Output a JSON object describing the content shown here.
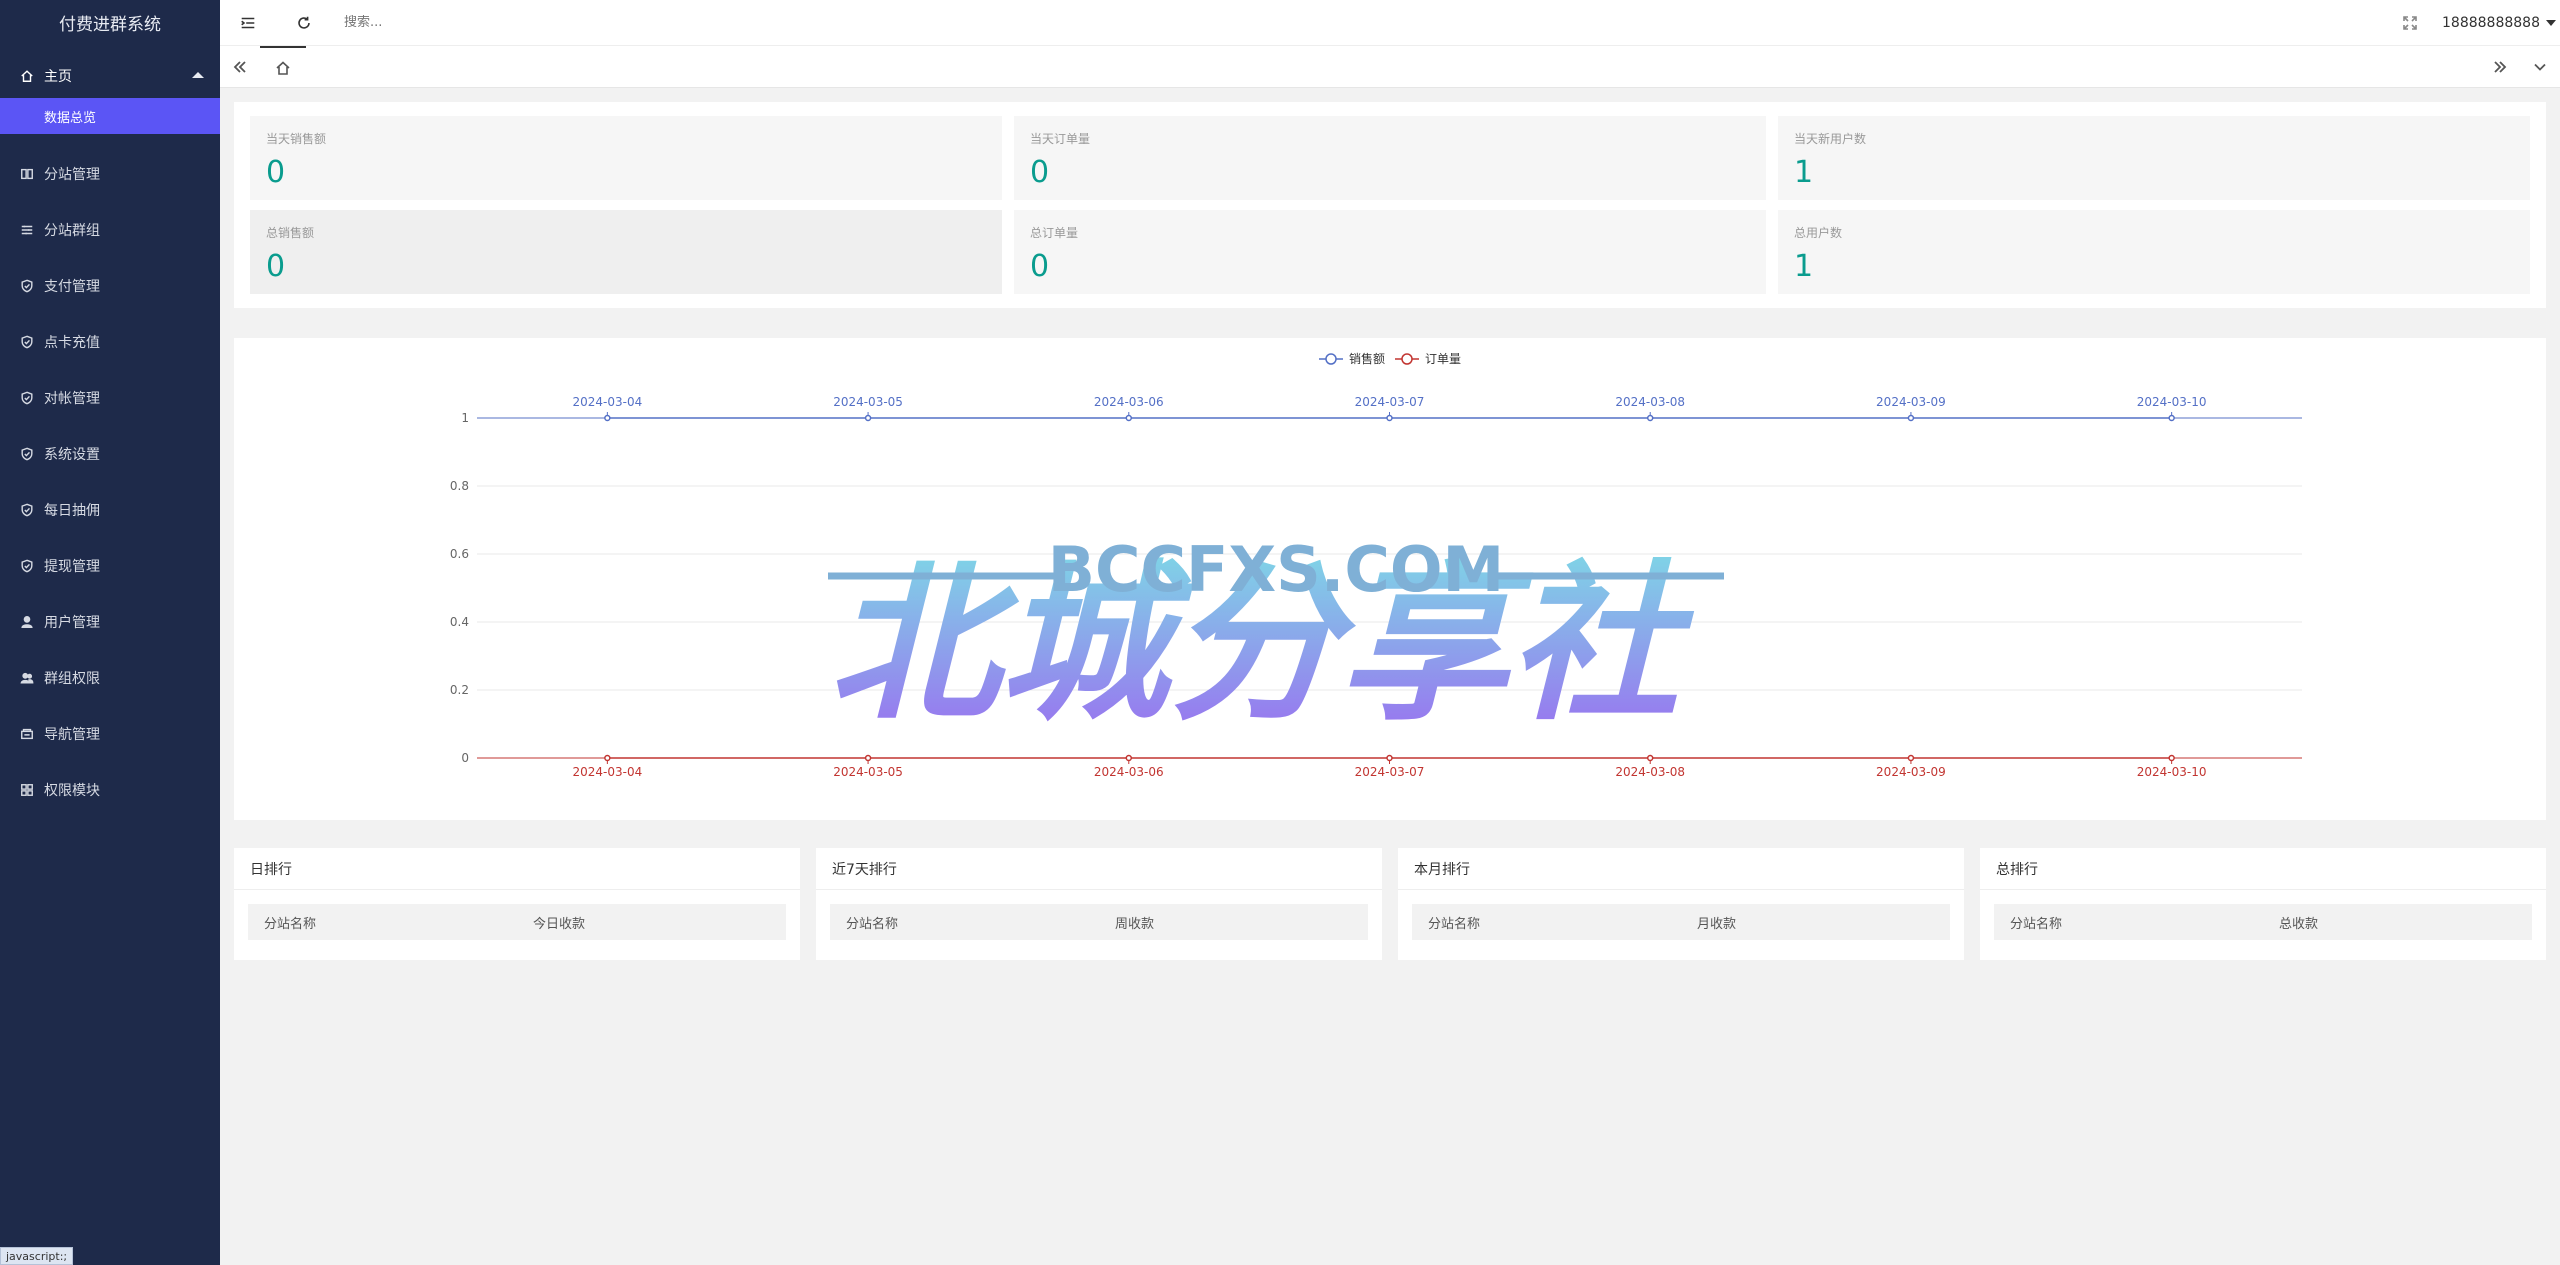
{
  "app": {
    "title": "付费进群系统"
  },
  "sidebar": {
    "group_label": "主页",
    "sub_label": "数据总览",
    "items": [
      {
        "label": "分站管理",
        "icon": "columns-icon"
      },
      {
        "label": "分站群组",
        "icon": "sliders-icon"
      },
      {
        "label": "支付管理",
        "icon": "shield-check-icon"
      },
      {
        "label": "点卡充值",
        "icon": "shield-check-icon"
      },
      {
        "label": "对帐管理",
        "icon": "shield-check-icon"
      },
      {
        "label": "系统设置",
        "icon": "shield-check-icon"
      },
      {
        "label": "每日抽佣",
        "icon": "shield-check-icon"
      },
      {
        "label": "提现管理",
        "icon": "shield-check-icon"
      },
      {
        "label": "用户管理",
        "icon": "user-icon"
      },
      {
        "label": "群组权限",
        "icon": "users-icon"
      },
      {
        "label": "导航管理",
        "icon": "navigation-icon"
      },
      {
        "label": "权限模块",
        "icon": "grid-icon"
      }
    ]
  },
  "header": {
    "search_placeholder": "搜索...",
    "username": "18888888888"
  },
  "stats": [
    {
      "label": "当天销售额",
      "value": "0"
    },
    {
      "label": "当天订单量",
      "value": "0"
    },
    {
      "label": "当天新用户数",
      "value": "1"
    },
    {
      "label": "总销售额",
      "value": "0"
    },
    {
      "label": "总订单量",
      "value": "0"
    },
    {
      "label": "总用户数",
      "value": "1"
    }
  ],
  "chart_data": {
    "type": "line",
    "x": [
      "2024-03-04",
      "2024-03-05",
      "2024-03-06",
      "2024-03-07",
      "2024-03-08",
      "2024-03-09",
      "2024-03-10"
    ],
    "series": [
      {
        "name": "销售额",
        "values": [
          1,
          1,
          1,
          1,
          1,
          1,
          1
        ],
        "color": "#5470c6",
        "axis": "top"
      },
      {
        "name": "订单量",
        "values": [
          0,
          0,
          0,
          0,
          0,
          0,
          0
        ],
        "color": "#c23531",
        "axis": "bottom"
      }
    ],
    "y_ticks": [
      "0",
      "0.2",
      "0.4",
      "0.6",
      "0.8",
      "1"
    ],
    "ylim": [
      0,
      1
    ],
    "legend_position": "top-center",
    "grid": true
  },
  "watermark": {
    "title": "北城分享社",
    "subtitle": "BCCFXS.COM"
  },
  "rankings": [
    {
      "title": "日排行",
      "col1": "分站名称",
      "col2": "今日收款"
    },
    {
      "title": "近7天排行",
      "col1": "分站名称",
      "col2": "周收款"
    },
    {
      "title": "本月排行",
      "col1": "分站名称",
      "col2": "月收款"
    },
    {
      "title": "总排行",
      "col1": "分站名称",
      "col2": "总收款"
    }
  ],
  "statusbar": {
    "text": "javascript:;"
  }
}
